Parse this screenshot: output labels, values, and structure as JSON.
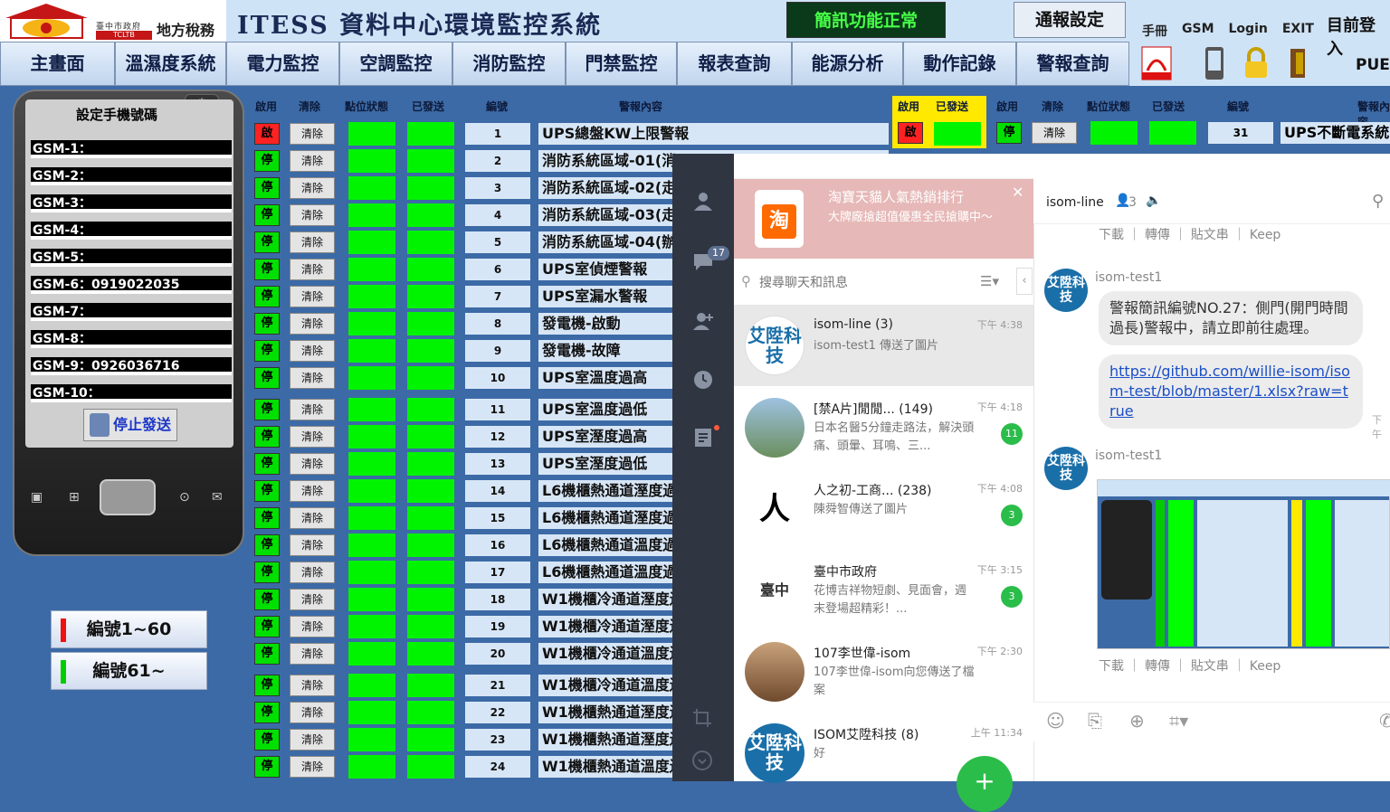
{
  "app": {
    "logo_small": "臺中市政府",
    "logo_big": "地方稅務局",
    "logo_acronym": "TCLTB",
    "title": "ITESS 資料中心環境監控系統",
    "sms_status": "簡訊功能正常",
    "notify_settings": "通報設定",
    "current_user_label": "目前登入",
    "current_user_value": "PUE"
  },
  "top_links": [
    "手冊",
    "GSM",
    "Login",
    "EXIT"
  ],
  "nav": [
    "主畫面",
    "溫濕度系統",
    "電力監控",
    "空調監控",
    "消防監控",
    "門禁監控",
    "報表查詢",
    "能源分析",
    "動作記錄",
    "警報查詢"
  ],
  "phone": {
    "title": "設定手機號碼",
    "gsm": [
      "GSM-1：",
      "GSM-2：",
      "GSM-3：",
      "GSM-4：",
      "GSM-5：",
      "GSM-6：0919022035",
      "GSM-7：",
      "GSM-8：",
      "GSM-9：0926036716",
      "GSM-10："
    ],
    "stop": "停止發送"
  },
  "ranges": [
    "編號1~60",
    "編號61~"
  ],
  "columns": {
    "enable": "啟用",
    "clear": "清除",
    "point": "點位狀態",
    "sent": "已發送",
    "num": "編號",
    "content": "警報內容"
  },
  "rows": [
    {
      "en": "啟",
      "clear": "清除",
      "num": "1",
      "content": "UPS總盤KW上限警報"
    },
    {
      "en": "停",
      "clear": "清除",
      "num": "2",
      "content": "消防系統區域-01(消"
    },
    {
      "en": "停",
      "clear": "清除",
      "num": "3",
      "content": "消防系統區域-02(走"
    },
    {
      "en": "停",
      "clear": "清除",
      "num": "4",
      "content": "消防系統區域-03(走"
    },
    {
      "en": "停",
      "clear": "清除",
      "num": "5",
      "content": "消防系統區域-04(辦"
    },
    {
      "en": "停",
      "clear": "清除",
      "num": "6",
      "content": "UPS室偵煙警報"
    },
    {
      "en": "停",
      "clear": "清除",
      "num": "7",
      "content": "UPS室漏水警報"
    },
    {
      "en": "停",
      "clear": "清除",
      "num": "8",
      "content": "發電機-啟動"
    },
    {
      "en": "停",
      "clear": "清除",
      "num": "9",
      "content": "發電機-故障"
    },
    {
      "en": "停",
      "clear": "清除",
      "num": "10",
      "content": "UPS室溫度過高"
    },
    {
      "en": "停",
      "clear": "清除",
      "num": "11",
      "content": "UPS室溫度過低"
    },
    {
      "en": "停",
      "clear": "清除",
      "num": "12",
      "content": "UPS室溼度過高"
    },
    {
      "en": "停",
      "clear": "清除",
      "num": "13",
      "content": "UPS室溼度過低"
    },
    {
      "en": "停",
      "clear": "清除",
      "num": "14",
      "content": "L6機櫃熱通道溼度過"
    },
    {
      "en": "停",
      "clear": "清除",
      "num": "15",
      "content": "L6機櫃熱通道溼度過"
    },
    {
      "en": "停",
      "clear": "清除",
      "num": "16",
      "content": "L6機櫃熱通道溫度過"
    },
    {
      "en": "停",
      "clear": "清除",
      "num": "17",
      "content": "L6機櫃熱通道溫度過"
    },
    {
      "en": "停",
      "clear": "清除",
      "num": "18",
      "content": "W1機櫃冷通道溼度過"
    },
    {
      "en": "停",
      "clear": "清除",
      "num": "19",
      "content": "W1機櫃冷通道溼度過"
    },
    {
      "en": "停",
      "clear": "清除",
      "num": "20",
      "content": "W1機櫃冷通道溫度過"
    },
    {
      "en": "停",
      "clear": "清除",
      "num": "21",
      "content": "W1機櫃冷通道溫度過"
    },
    {
      "en": "停",
      "clear": "清除",
      "num": "22",
      "content": "W1機櫃熱通道溼度過"
    },
    {
      "en": "停",
      "clear": "清除",
      "num": "23",
      "content": "W1機櫃熱通道溼度過"
    },
    {
      "en": "停",
      "clear": "清除",
      "num": "24",
      "content": "W1機櫃熱通道溫度過"
    }
  ],
  "right_table": {
    "enable": "啟用",
    "sent": "已發送",
    "enable2": "啟用",
    "clear": "清除",
    "point": "點位狀態",
    "sent2": "已發送",
    "num": "編號",
    "content": "警報內容",
    "row_en": "停",
    "row_clear": "清除",
    "row_en_red": "啟",
    "row_num": "31",
    "row_content": "UPS不斷電系統"
  },
  "line": {
    "unread": "17",
    "ad_title": "淘寶天貓人氣熱銷排行",
    "ad_sub": "大牌廠搶超值優惠全民搶購中～",
    "ad_logo": "淘",
    "search_placeholder": "搜尋聊天和訊息",
    "chats": [
      {
        "name": "isom-line (3)",
        "preview": "isom-test1 傳送了圖片",
        "time": "下午 4:38",
        "badge": "",
        "avatar": "艾陞科技"
      },
      {
        "name": "[禁A片]閒閒...  (149)",
        "preview": "日本名醫5分鐘走路法，解決頭痛、頭暈、耳鳴、三...",
        "time": "下午 4:18",
        "badge": "11",
        "avatar": ""
      },
      {
        "name": "人之初-工商...  (238)",
        "preview": "陳舜智傳送了圖片",
        "time": "下午 4:08",
        "badge": "3",
        "avatar": ""
      },
      {
        "name": "臺中市政府",
        "preview": "花博吉祥物短劇、見面會，週末登場超精彩！...",
        "time": "下午 3:15",
        "badge": "3",
        "avatar": ""
      },
      {
        "name": "107李世偉-isom",
        "preview": "107李世偉-isom向您傳送了檔案",
        "time": "下午 2:30",
        "badge": "",
        "avatar": ""
      },
      {
        "name": "ISOM艾陞科技 (8)",
        "preview": "好",
        "time": "上午 11:34",
        "badge": "",
        "avatar": "艾陞科技"
      }
    ],
    "conv_title": "isom-line",
    "conv_members": "3",
    "actions": [
      "下載",
      "轉傳",
      "貼文串",
      "Keep"
    ],
    "sender": "isom-test1",
    "msg1": "警報簡訊編號NO.27：側門(開門時間過長)警報中，請立即前往處理。",
    "msg_link": "https://github.com/willie-isom/isom-test/blob/master/1.xlsx?raw=true",
    "time_edge": "下午"
  },
  "colors": {
    "enable_green": "#00e000",
    "alarm_red": "#ff2222",
    "status_green": "#00f400",
    "line_green": "#2bbd4a",
    "ad_pink": "#e6b8b7"
  }
}
